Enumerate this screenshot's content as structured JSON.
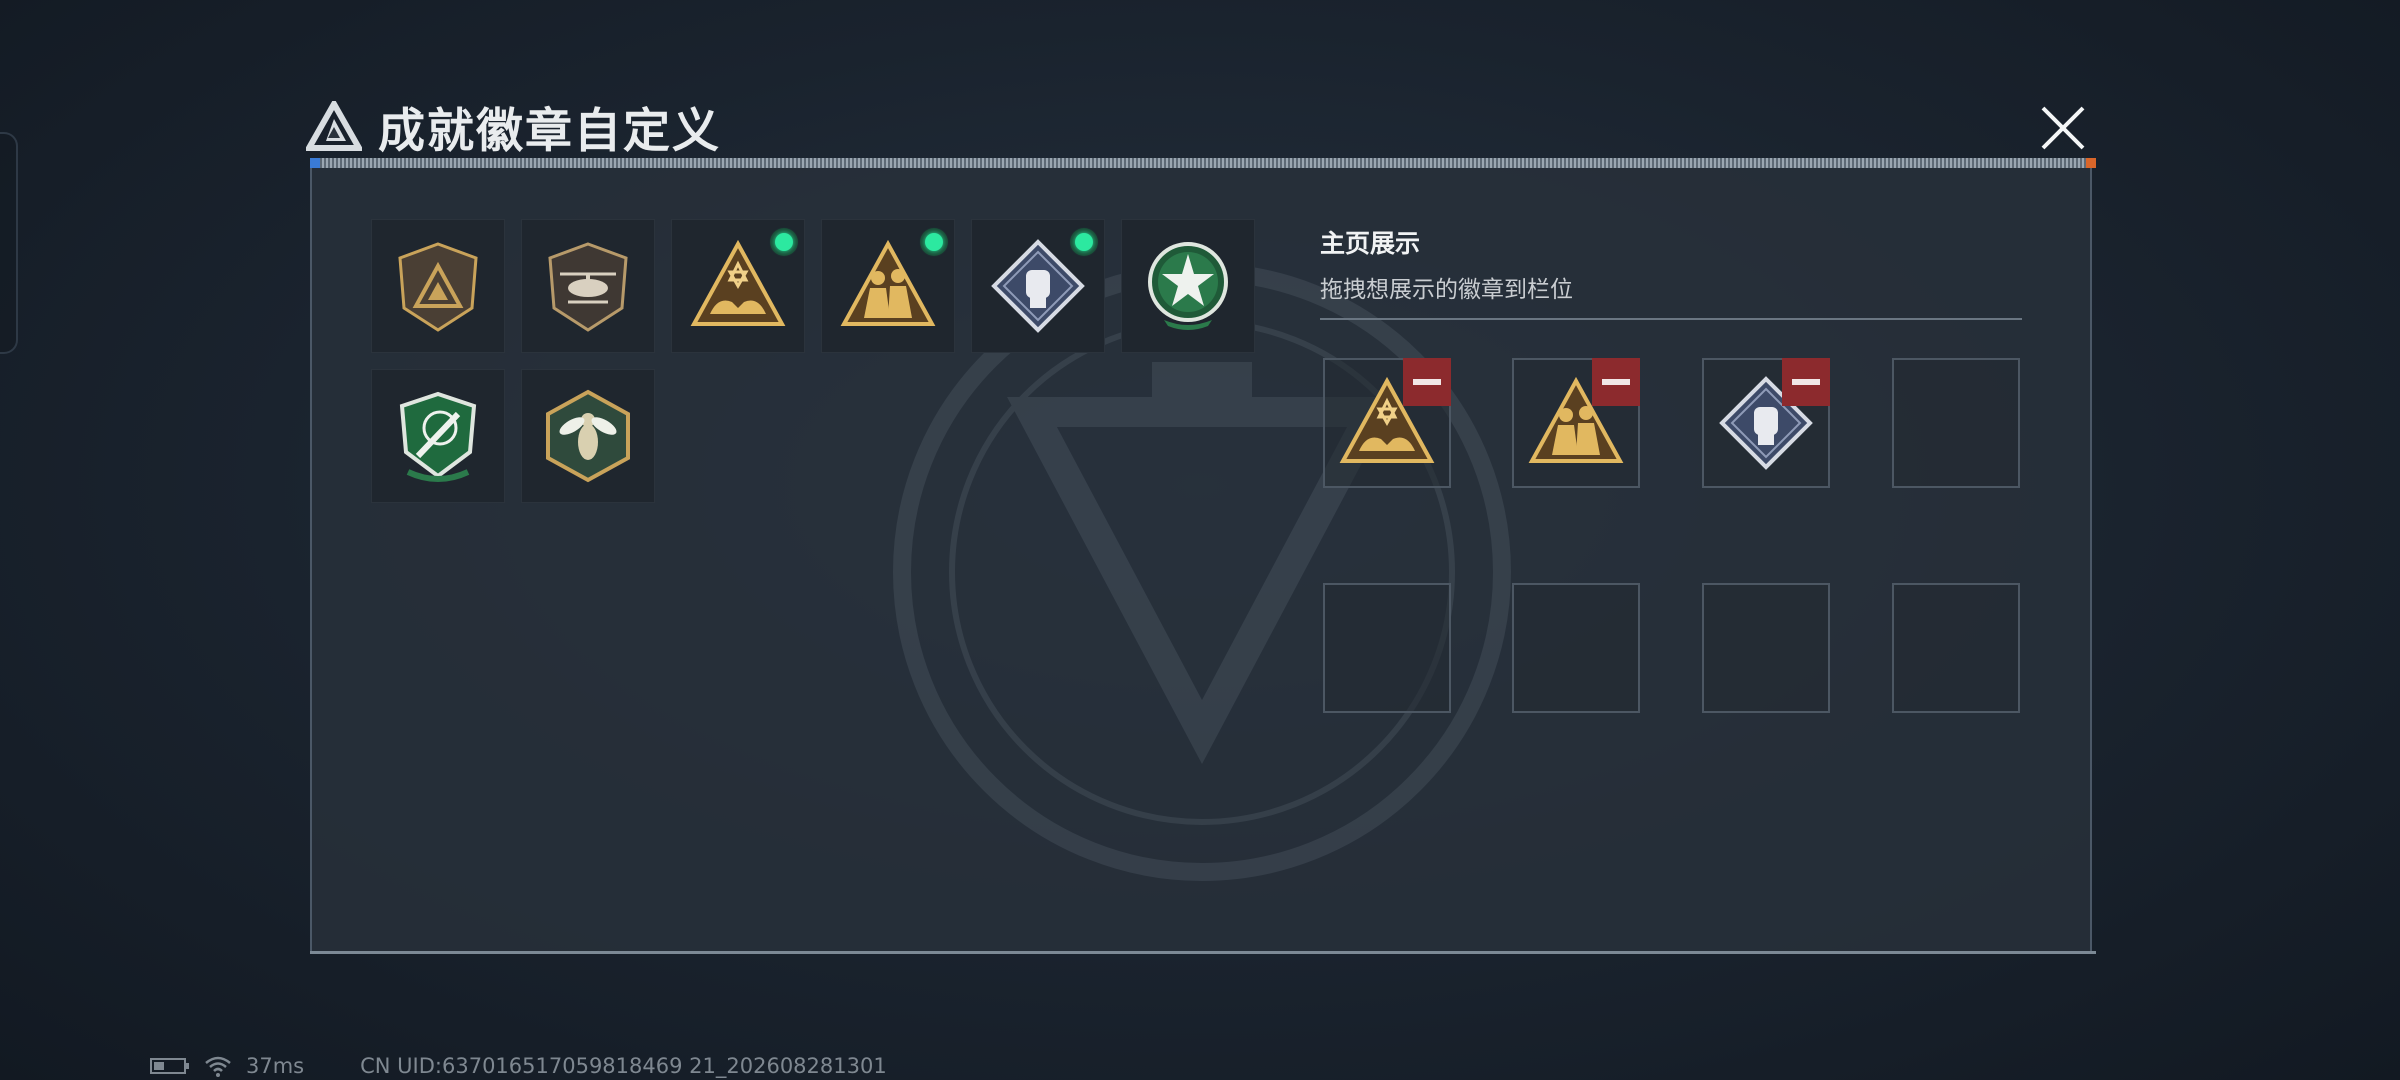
{
  "header": {
    "title": "成就徽章自定义",
    "close_icon": "close-icon"
  },
  "colors": {
    "accent_equipped": "#2ce9a0",
    "remove_red": "#8c2a2d",
    "gold": "#c9a35a",
    "green_badge": "#1f6a3e"
  },
  "collection": {
    "badges": [
      {
        "icon": "triangle-shield-badge-icon",
        "equipped": false
      },
      {
        "icon": "helicopter-shield-badge-icon",
        "equipped": false
      },
      {
        "icon": "triangle-star-hands-badge-icon",
        "equipped": true
      },
      {
        "icon": "triangle-soldiers-badge-icon",
        "equipped": true
      },
      {
        "icon": "diamond-fist-badge-icon",
        "equipped": true
      },
      {
        "icon": "green-star-wreath-badge-icon",
        "equipped": false
      },
      {
        "icon": "green-shield-knife-badge-icon",
        "equipped": false
      },
      {
        "icon": "hexagon-wasp-badge-icon",
        "equipped": false
      }
    ]
  },
  "display": {
    "title": "主页展示",
    "subtitle": "拖拽想展示的徽章到栏位",
    "slots": [
      {
        "icon": "triangle-star-hands-badge-icon",
        "filled": true
      },
      {
        "icon": "triangle-soldiers-badge-icon",
        "filled": true
      },
      {
        "icon": "diamond-fist-badge-icon",
        "filled": true
      },
      {
        "icon": "",
        "filled": false
      },
      {
        "icon": "",
        "filled": false
      },
      {
        "icon": "",
        "filled": false
      },
      {
        "icon": "",
        "filled": false
      },
      {
        "icon": "",
        "filled": false
      }
    ]
  },
  "status_bar": {
    "ping": "37ms",
    "uid": "CN UID:637016517059818469 21_202608281301"
  }
}
